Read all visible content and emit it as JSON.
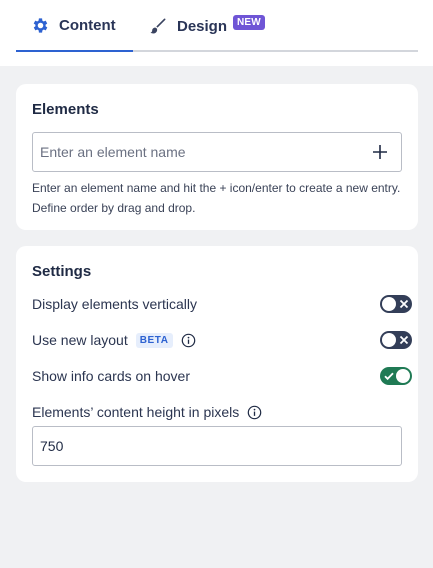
{
  "tabs": {
    "content_label": "Content",
    "design_label": "Design",
    "design_badge": "NEW",
    "content_icon": "gear-icon",
    "design_icon": "paintbrush-icon",
    "active": "Content"
  },
  "elements": {
    "title": "Elements",
    "input_placeholder": "Enter an element name",
    "input_value": "",
    "add_icon": "plus-icon",
    "helper_text": "Enter an element name and hit the + icon/enter to create a new entry. Define order by drag and drop."
  },
  "settings": {
    "title": "Settings",
    "display_vertical": {
      "label": "Display elements vertically",
      "enabled": false
    },
    "new_layout": {
      "label": "Use new layout",
      "badge": "BETA",
      "enabled": false,
      "icon": "info-icon"
    },
    "info_cards": {
      "label": "Show info cards on hover",
      "enabled": true
    },
    "content_height": {
      "label": "Elements’ content height in pixels",
      "value": "750",
      "icon": "info-icon"
    }
  },
  "colors": {
    "accent": "#2d62d1",
    "badge_new": "#6f55d6",
    "toggle_off": "#333e58",
    "toggle_on": "#1f7a54",
    "background": "#f0f1f3"
  }
}
